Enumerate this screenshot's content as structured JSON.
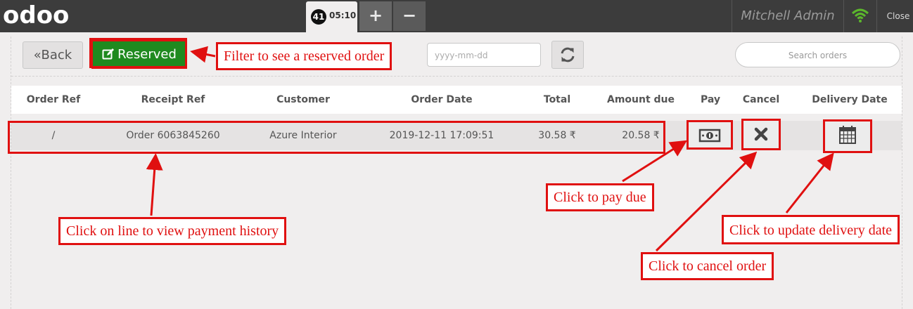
{
  "topbar": {
    "logo": "odoo",
    "order_number": "41",
    "order_time": "05:10",
    "add_label": "+",
    "remove_label": "−",
    "user_name": "Mitchell Admin",
    "close_label": "Close"
  },
  "controls": {
    "back_label": "Back",
    "reserved_label": "Reserved",
    "date_placeholder": "yyyy-mm-dd",
    "search_placeholder": "Search orders"
  },
  "table": {
    "headers": [
      "Order Ref",
      "Receipt Ref",
      "Customer",
      "Order Date",
      "Total",
      "Amount due",
      "Pay",
      "Cancel",
      "Delivery Date"
    ],
    "rows": [
      {
        "order_ref": "/",
        "receipt_ref": "Order 6063845260",
        "customer": "Azure Interior",
        "order_date": "2019-12-11 17:09:51",
        "total": "30.58 ₹",
        "amount_due": "20.58 ₹"
      }
    ]
  },
  "annotations": {
    "filter_reserved": "Filter to see a reserved order",
    "view_history": "Click on line to view payment history",
    "pay_due": "Click to pay due",
    "cancel_order": "Click to cancel order",
    "update_delivery": "Click to update delivery date"
  },
  "colors": {
    "topbar": "#3c3c3c",
    "reserved_green": "#1f8a1f",
    "annotation_red": "#e01010",
    "wifi_green": "#5cb82c"
  },
  "icons": {
    "back": "double-chevron-left-icon",
    "reserved": "edit-icon",
    "refresh": "refresh-icon",
    "search": "search-icon",
    "pay": "money-icon",
    "cancel": "close-icon",
    "delivery": "calendar-icon",
    "wifi": "wifi-icon"
  }
}
